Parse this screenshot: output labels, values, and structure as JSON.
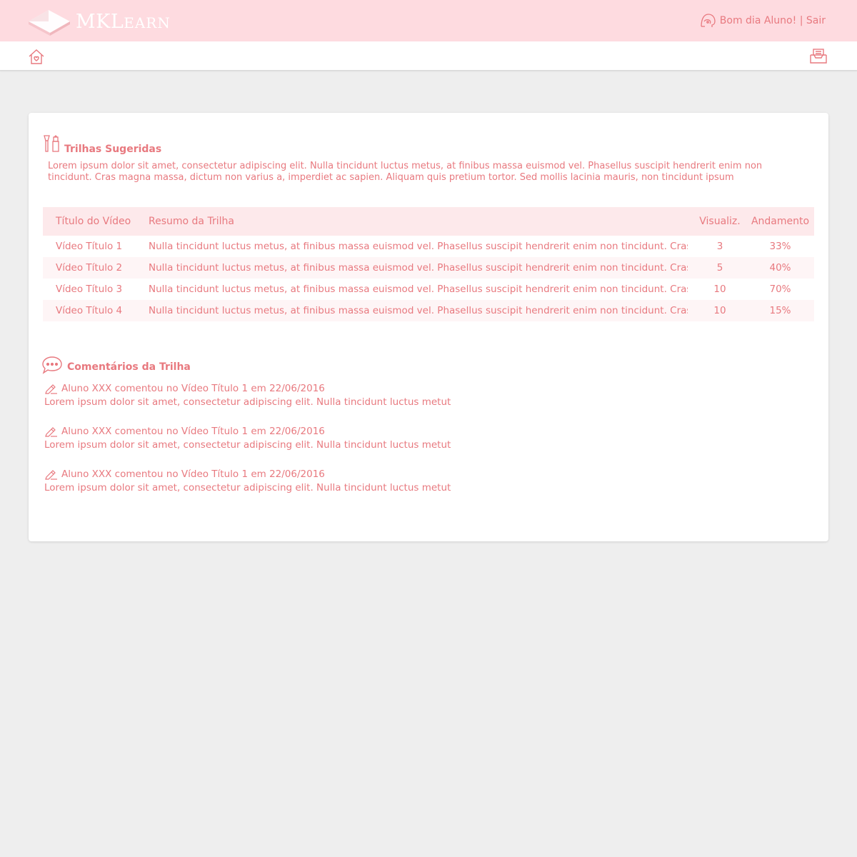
{
  "brand": {
    "name_prefix": "MK",
    "name_first_letter": "L",
    "name_rest": "EARN"
  },
  "header": {
    "greeting": "Bom dia Aluno!",
    "separator": " | ",
    "logout_label": "Sair"
  },
  "suggested": {
    "title": "Trilhas Sugeridas",
    "description": "Lorem ipsum dolor sit amet, consectetur adipiscing elit. Nulla tincidunt luctus metus, at finibus massa euismod vel. Phasellus suscipit hendrerit enim non tincidunt. Cras magna massa, dictum non varius a, imperdiet ac sapien. Aliquam quis pretium tortor. Sed mollis lacinia mauris, non tincidunt ipsum",
    "columns": [
      "Título do Vídeo",
      "Resumo da Trilha",
      "Visualiz.",
      "Andamento"
    ],
    "rows": [
      {
        "title": "Vídeo Título 1",
        "summary": "Nulla tincidunt luctus metus, at finibus massa euismod vel. Phasellus suscipit hendrerit enim non tincidunt. Cras magna...",
        "views": "3",
        "progress": "33%"
      },
      {
        "title": "Vídeo Título 2",
        "summary": "Nulla tincidunt luctus metus, at finibus massa euismod vel. Phasellus suscipit hendrerit enim non tincidunt. Cras magna...",
        "views": "5",
        "progress": "40%"
      },
      {
        "title": "Vídeo Título 3",
        "summary": "Nulla tincidunt luctus metus, at finibus massa euismod vel. Phasellus suscipit hendrerit enim non tincidunt. Cras magna...",
        "views": "10",
        "progress": "70%"
      },
      {
        "title": "Vídeo Título 4",
        "summary": "Nulla tincidunt luctus metus, at finibus massa euismod vel. Phasellus suscipit hendrerit enim non tincidunt. Cras magna...",
        "views": "10",
        "progress": "15%"
      }
    ]
  },
  "comments": {
    "title": "Comentários da Trilha",
    "items": [
      {
        "header": "Aluno XXX comentou no Vídeo Título 1 em 22/06/2016",
        "text": "Lorem ipsum dolor sit amet, consectetur adipiscing elit. Nulla tincidunt luctus metut"
      },
      {
        "header": "Aluno XXX comentou no Vídeo Título 1 em 22/06/2016",
        "text": "Lorem ipsum dolor sit amet, consectetur adipiscing elit. Nulla tincidunt luctus metut"
      },
      {
        "header": "Aluno XXX comentou no Vídeo Título 1 em 22/06/2016",
        "text": "Lorem ipsum dolor sit amet, consectetur adipiscing elit. Nulla tincidunt luctus metut"
      }
    ]
  },
  "icons": {
    "logo": "diamond-logo-icon",
    "user": "user-head-icon",
    "home": "home-icon",
    "inbox": "inbox-icon",
    "suggested": "tools-icon",
    "comments": "chat-bubble-icon",
    "comment_item": "pencil-icon"
  },
  "colors": {
    "accent": "#e8797f",
    "header_bg": "#fedbe0",
    "page_bg": "#eeeeee",
    "table_header_bg": "#fde9eb"
  }
}
